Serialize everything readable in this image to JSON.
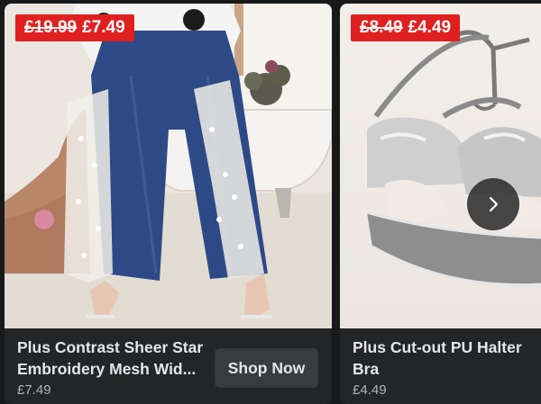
{
  "cards": [
    {
      "sale_tag": {
        "old_price": "£19.99",
        "new_price": "£7.49"
      },
      "title_lines": [
        "Plus Contrast Sheer Star",
        "Embroidery Mesh Wid..."
      ],
      "price": "£7.49",
      "cta_label": "Shop Now"
    },
    {
      "sale_tag": {
        "old_price": "£8.49",
        "new_price": "£4.49"
      },
      "title_lines": [
        "Plus Cut-out PU Halter",
        "Bra"
      ],
      "price": "£4.49"
    }
  ],
  "icons": {
    "next": "chevron-right-icon"
  },
  "colors": {
    "page_bg": "#18191a",
    "card_bg": "#242526",
    "sale_red": "#e02020",
    "button_bg": "#3a3b3c",
    "text": "#e4e6eb",
    "muted": "#b0b3b8"
  }
}
